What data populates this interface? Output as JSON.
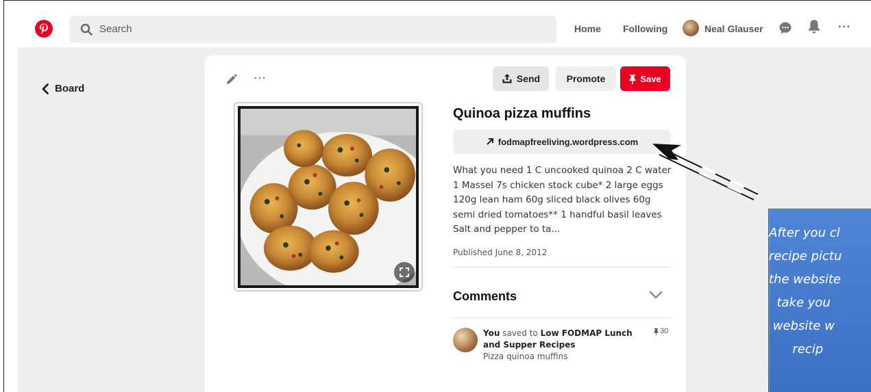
{
  "topbar": {
    "search_placeholder": "Search",
    "nav_home": "Home",
    "nav_following": "Following",
    "user_name": "Neal Glauser",
    "more": "···"
  },
  "sidebar": {
    "back_label": "Board"
  },
  "pin": {
    "actions": {
      "more": "···",
      "send": "Send",
      "promote": "Promote",
      "save": "Save"
    },
    "title": "Quinoa pizza muffins",
    "link": "fodmapfreeliving.wordpress.com",
    "description": "What you need 1 C uncooked quinoa 2 C water 1 Massel 7s chicken stock cube* 2 large eggs 120g lean ham 60g sliced black olives 60g semi dried tomatoes** 1 handful basil leaves Salt and pepper to ta...",
    "published": "Published June 8, 2012"
  },
  "comments": {
    "title": "Comments",
    "saved_by": "You",
    "saved_mid": "saved to",
    "board_name": "Low FODMAP Lunch and Supper Recipes",
    "pin_note": "Pizza quinoa muffins",
    "save_count": "30"
  },
  "annotation": {
    "text": "After you cl\nrecipe pictu\nthe website\n  take you\n website w\n      recip"
  },
  "colors": {
    "brand_red": "#e60023",
    "callout_blue": "#4472c4"
  }
}
